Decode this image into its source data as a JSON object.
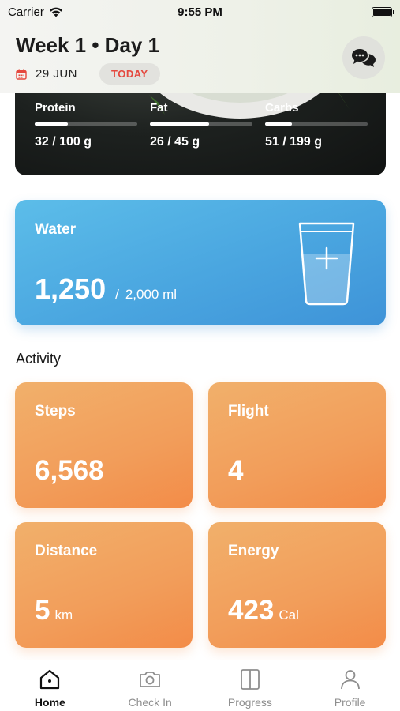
{
  "status_bar": {
    "carrier": "Carrier",
    "time": "9:55 PM",
    "battery_level": 1.0
  },
  "header": {
    "title": "Week 1 • Day 1",
    "date": "29 JUN",
    "today_label": "TODAY",
    "icons": {
      "calendar": "calendar-icon",
      "chat": "chat-bubbles-icon"
    }
  },
  "macros": {
    "items": [
      {
        "label": "Protein",
        "value": "32 / 100 g",
        "progress": 0.32
      },
      {
        "label": "Fat",
        "value": "26 / 45 g",
        "progress": 0.58
      },
      {
        "label": "Carbs",
        "value": "51 / 199 g",
        "progress": 0.26
      }
    ]
  },
  "water": {
    "title": "Water",
    "current": "1,250",
    "separator": "/",
    "goal": "2,000 ml",
    "progress": 0.625,
    "icon": "water-glass-add-icon",
    "color": "#4aa6e0"
  },
  "activity": {
    "title": "Activity",
    "color": "#f29d5a",
    "cards": [
      {
        "label": "Steps",
        "value": "6,568",
        "unit": ""
      },
      {
        "label": "Flight",
        "value": "4",
        "unit": ""
      },
      {
        "label": "Distance",
        "value": "5",
        "unit": "km"
      },
      {
        "label": "Energy",
        "value": "423",
        "unit": "Cal"
      }
    ]
  },
  "tabs": [
    {
      "label": "Home",
      "icon": "home-icon",
      "active": true
    },
    {
      "label": "Check In",
      "icon": "camera-icon",
      "active": false
    },
    {
      "label": "Progress",
      "icon": "progress-book-icon",
      "active": false
    },
    {
      "label": "Profile",
      "icon": "person-icon",
      "active": false
    }
  ]
}
